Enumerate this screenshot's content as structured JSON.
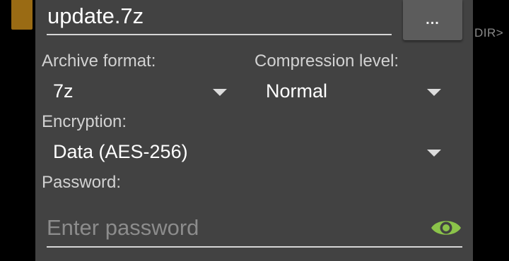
{
  "background": {
    "dir_label": "DIR>"
  },
  "dialog": {
    "filename": "update.7z",
    "browse_label": "...",
    "archive_format": {
      "label": "Archive format:",
      "value": "7z"
    },
    "compression_level": {
      "label": "Compression level:",
      "value": "Normal"
    },
    "encryption": {
      "label": "Encryption:",
      "value": "Data (AES-256)"
    },
    "password": {
      "label": "Password:",
      "placeholder": "Enter password",
      "value": ""
    }
  },
  "icons": {
    "folder": "folder-icon",
    "dropdown": "chevron-down-icon",
    "show_password": "eye-icon"
  },
  "colors": {
    "dialog_background": "#424242",
    "accent_green": "#8bc34a",
    "folder_brown": "#9a6b14"
  }
}
